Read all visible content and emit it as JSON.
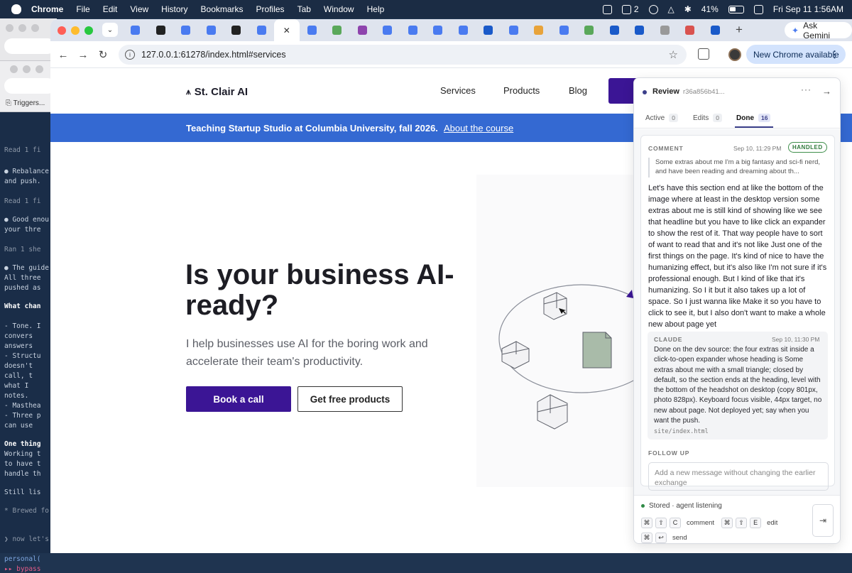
{
  "menubar": {
    "app": "Chrome",
    "items": [
      "File",
      "Edit",
      "View",
      "History",
      "Bookmarks",
      "Profiles",
      "Tab",
      "Window",
      "Help"
    ],
    "status_count": "2",
    "battery": "41%",
    "datetime": "Fri Sep 11  1:56AM"
  },
  "bg_window": {
    "triggers_label": "Triggers...",
    "terminal_lines": [
      {
        "text": "Read 1 fi",
        "cls": "g"
      },
      {
        "text": "● Rebalance",
        "cls": ""
      },
      {
        "text": "  and push.",
        "cls": ""
      },
      {
        "text": "Read 1 fi",
        "cls": "g"
      },
      {
        "text": "● Good enou",
        "cls": ""
      },
      {
        "text": "  your thre",
        "cls": ""
      },
      {
        "text": "Ran 1 she",
        "cls": "g"
      },
      {
        "text": "● The guide",
        "cls": ""
      },
      {
        "text": "  All three",
        "cls": ""
      },
      {
        "text": "  pushed as",
        "cls": ""
      },
      {
        "text": "What chan",
        "cls": "w"
      },
      {
        "text": "- Tone. I",
        "cls": ""
      },
      {
        "text": "  convers",
        "cls": ""
      },
      {
        "text": "  answers",
        "cls": ""
      },
      {
        "text": "- Structu",
        "cls": ""
      },
      {
        "text": "  doesn't",
        "cls": ""
      },
      {
        "text": "  call, t",
        "cls": ""
      },
      {
        "text": "  what I",
        "cls": ""
      },
      {
        "text": "  notes.",
        "cls": ""
      },
      {
        "text": "- Masthea",
        "cls": ""
      },
      {
        "text": "- Three p",
        "cls": ""
      },
      {
        "text": "  can use",
        "cls": ""
      },
      {
        "text": "One thing",
        "cls": "w"
      },
      {
        "text": "Working t",
        "cls": ""
      },
      {
        "text": "to have t",
        "cls": ""
      },
      {
        "text": "handle th",
        "cls": ""
      },
      {
        "text": "Still lis",
        "cls": ""
      },
      {
        "text": "* Brewed fo",
        "cls": "g"
      },
      {
        "text": "❯ now let's",
        "cls": "g"
      },
      {
        "text": "personal(",
        "cls": "b"
      },
      {
        "text": "▸▸ bypass",
        "cls": "p"
      }
    ]
  },
  "browser": {
    "active_tab_close": "✕",
    "tab_colors": [
      "#4a7bf0",
      "#222222",
      "#4a7bf0",
      "#4a7bf0",
      "#222222",
      "#4a7bf0",
      null,
      "#4a7bf0",
      "#5aa85a",
      "#8e44ad",
      "#4a7bf0",
      "#4a7bf0",
      "#4a7bf0",
      "#4a7bf0",
      "#1a5ac9",
      "#4a7bf0",
      "#e8a33a",
      "#4a7bf0",
      "#5aa85a",
      "#1a5ac9",
      "#1a5ac9",
      "#999999",
      "#d9534f",
      "#1a5ac9"
    ],
    "new_tab": "+",
    "ask_gemini": "Ask Gemini",
    "url": "127.0.0.1:61278/index.html#services",
    "new_chrome": "New Chrome available"
  },
  "site": {
    "logo": "St. Clair AI",
    "nav": [
      "Services",
      "Products",
      "Blog"
    ],
    "banner_text": "Teaching Startup Studio at Columbia University, fall 2026.",
    "banner_link": "About the course",
    "hero_title": "Is your business AI-ready?",
    "hero_sub": "I help businesses use AI for the boring work and accelerate their team's productivity.",
    "cta_primary": "Book a call",
    "cta_secondary": "Get free products"
  },
  "review": {
    "title": "Review",
    "hash": "r36a856b41...",
    "tabs": [
      {
        "label": "Active",
        "count": "0"
      },
      {
        "label": "Edits",
        "count": "0"
      },
      {
        "label": "Done",
        "count": "16"
      }
    ],
    "comment": {
      "label": "COMMENT",
      "date": "Sep 10, 11:29 PM",
      "badge": "HANDLED",
      "quote": "Some extras about me I'm a big fantasy and sci-fi nerd, and have been reading and dreaming about th...",
      "message": "Let's have this section end at like the bottom of the image where at least in the desktop version some extras about me is still kind of showing like we see that headline but you have to like click an expander to show the rest of it. That way people have to sort of want to read that and it's not like Just one of the first things on the page. It's kind of nice to have the humanizing effect, but it's also like I'm not sure if it's professional enough. But I kind of like that it's humanizing. So I it but it also takes up a lot of space. So I just wanna like Make it so you have to click to see it, but I also don't want to make a whole new about page yet"
    },
    "reply": {
      "label": "CLAUDE",
      "date": "Sep 10, 11:30 PM",
      "message": "Done on the dev source: the four extras sit inside a click-to-open expander whose heading is Some extras about me with a small triangle; closed by default, so the section ends at the heading, level with the bottom of the headshot on desktop (copy 801px, photo 828px). Keyboard focus visible, 44px target, no new about page. Not deployed yet; say when you want the push.",
      "file": "site/index.html"
    },
    "follow_up_label": "FOLLOW UP",
    "follow_up_placeholder": "Add a new message without changing the earlier exchange",
    "status": "Stored · agent listening",
    "shortcuts": [
      {
        "keys": [
          "⌘",
          "⇧",
          "C"
        ],
        "label": "comment"
      },
      {
        "keys": [
          "⌘",
          "⇧",
          "E"
        ],
        "label": "edit"
      },
      {
        "keys": [
          "⌘",
          "↩"
        ],
        "label": "send"
      }
    ]
  }
}
